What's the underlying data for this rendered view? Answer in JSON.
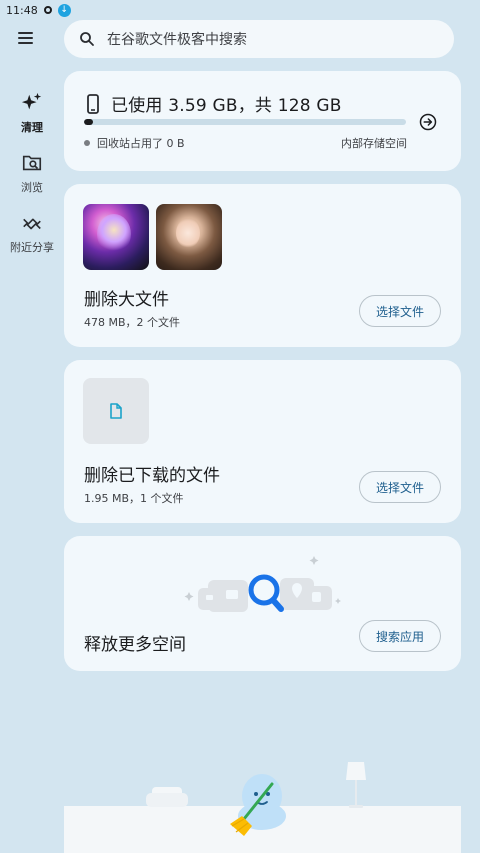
{
  "status_bar": {
    "time": "11:48"
  },
  "search": {
    "placeholder": "在谷歌文件极客中搜索"
  },
  "nav": [
    {
      "id": "clean",
      "label": "清理",
      "icon": "sparkle-icon",
      "active": true
    },
    {
      "id": "browse",
      "label": "浏览",
      "icon": "folder-search-icon",
      "active": false
    },
    {
      "id": "nearby",
      "label": "附近分享",
      "icon": "nearby-share-icon",
      "active": false
    }
  ],
  "storage": {
    "title": "已使用 3.59 GB，共 128 GB",
    "used_fraction": 0.028,
    "recycle_bin": "回收站占用了 0 B",
    "location": "内部存储空间"
  },
  "large_files": {
    "title": "删除大文件",
    "subtitle": "478 MB，2 个文件",
    "button": "选择文件"
  },
  "downloads": {
    "title": "删除已下载的文件",
    "subtitle": "1.95 MB，1 个文件",
    "button": "选择文件"
  },
  "free_space": {
    "title": "释放更多空间",
    "button": "搜索应用"
  },
  "colors": {
    "background": "#d3e5f0",
    "card": "#f2f8fc",
    "accent": "#1f5f8e",
    "file_icon": "#1aa3c9",
    "search_lens": "#1a73e8"
  }
}
